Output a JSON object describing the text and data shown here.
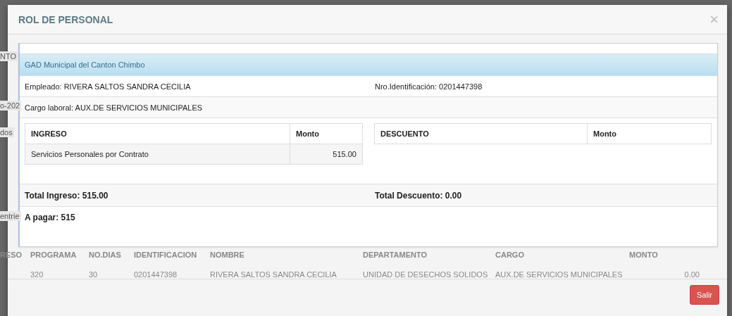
{
  "background": {
    "fragments": [
      "NTO",
      "o-202",
      "dos",
      "entrie"
    ],
    "table": {
      "columns": [
        "RESO",
        "PROGRAMA",
        "NO.DIAS",
        "IDENTIFICACION",
        "NOMBRE",
        "DEPARTAMENTO",
        "CARGO",
        "MONTO"
      ],
      "rows": [
        [
          "",
          "320",
          "30",
          "0201447398",
          "RIVERA SALTOS SANDRA CECILIA",
          "UNIDAD DE DESECHOS SOLIDOS",
          "AUX.DE SERVICIOS MUNICIPALES",
          "0.00"
        ]
      ]
    }
  },
  "modal": {
    "title": "ROL DE PERSONAL",
    "close": "×",
    "institution": "GAD Municipal del Canton Chimbo",
    "employee": "Empleado: RIVERA SALTOS SANDRA CECILIA",
    "id_number": "Nro.Identificación: 0201447398",
    "position": "Cargo laboral: AUX.DE SERVICIOS MUNICIPALES",
    "income": {
      "columns": [
        "INGRESO",
        "Monto"
      ],
      "rows": [
        {
          "concept": "Servicios Personales por Contrato",
          "amount": "515.00"
        }
      ]
    },
    "deductions": {
      "columns": [
        "DESCUENTO",
        "Monto"
      ]
    },
    "total_income": "Total Ingreso: 515.00",
    "total_deductions": "Total Descuento: 0.00",
    "to_pay": "A pagar: 515",
    "buttons": [
      {
        "label": "Salir"
      }
    ]
  }
}
